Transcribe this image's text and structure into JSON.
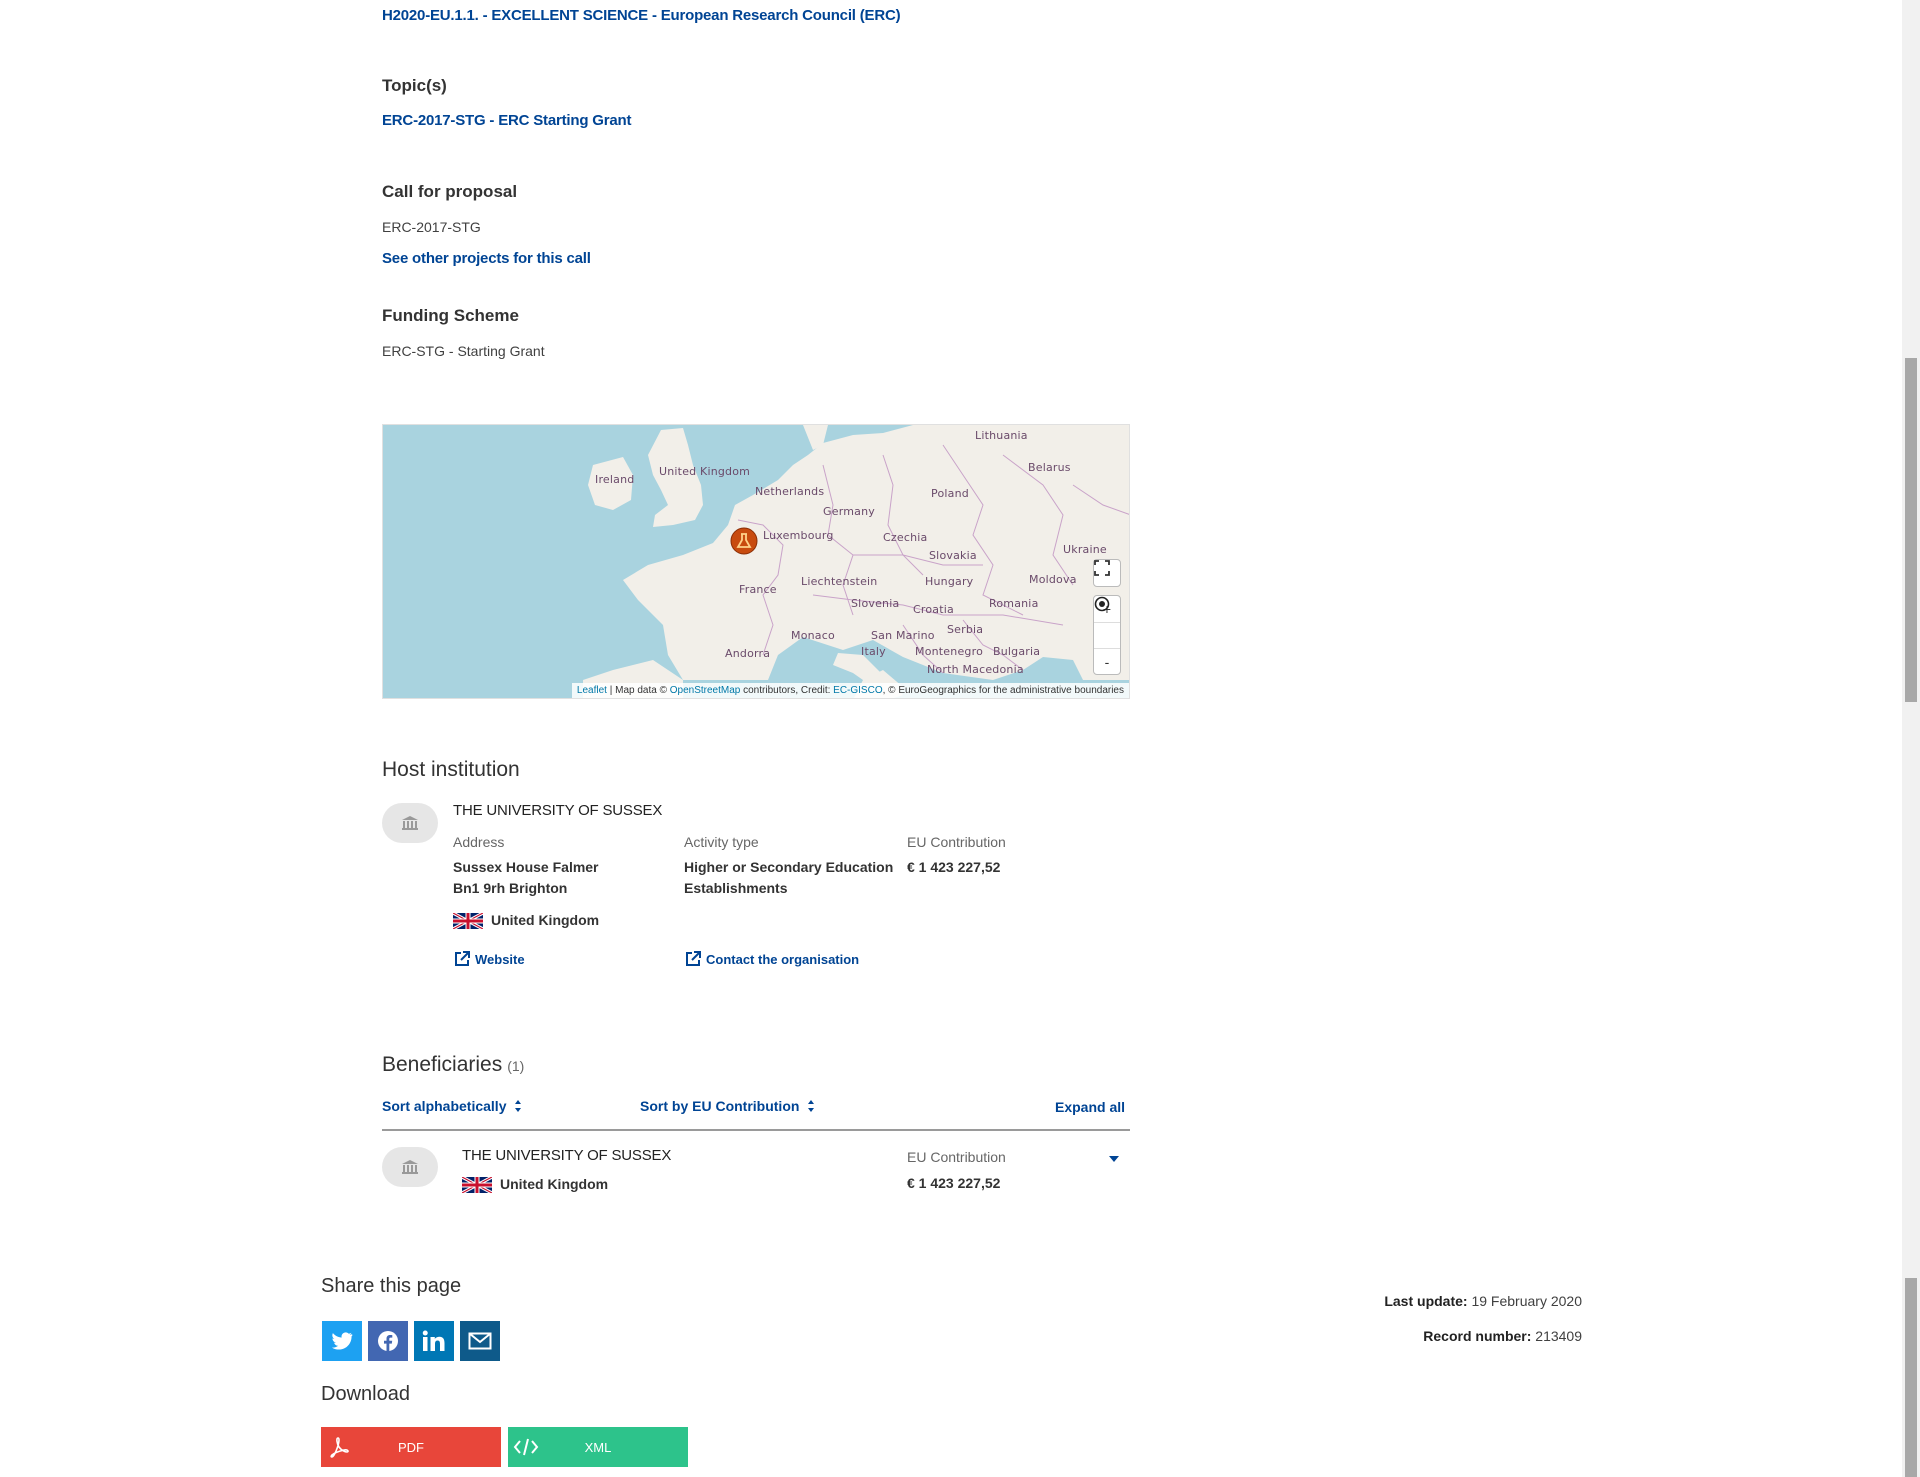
{
  "programme": {
    "link": "H2020-EU.1.1. - EXCELLENT SCIENCE - European Research Council (ERC)"
  },
  "topics": {
    "heading": "Topic(s)",
    "link": "ERC-2017-STG - ERC Starting Grant"
  },
  "call": {
    "heading": "Call for proposal",
    "value": "ERC-2017-STG",
    "link": "See other projects for this call"
  },
  "funding": {
    "heading": "Funding Scheme",
    "value": "ERC-STG - Starting Grant"
  },
  "map": {
    "labels": [
      "Lithuania",
      "Belarus",
      "Ireland",
      "United Kingdom",
      "Netherlands",
      "Poland",
      "Germany",
      "Luxembourg",
      "Czechia",
      "Ukraine",
      "Slovakia",
      "Liechtenstein",
      "Hungary",
      "Moldova",
      "France",
      "Slovenia",
      "Croatia",
      "Romania",
      "Serbia",
      "Monaco",
      "San Marino",
      "Italy",
      "Montenegro",
      "Bulgaria",
      "Andorra",
      "North Macedonia"
    ],
    "zoom_in": "+",
    "zoom_out": "-",
    "attribution": {
      "leaflet": "Leaflet",
      "sep": " | Map data © ",
      "osm": "OpenStreetMap",
      "mid": " contributors, Credit: ",
      "gisco": "EC-GISCO",
      "end": ", © EuroGeographics for the administrative boundaries"
    },
    "colors": {
      "sea": "#a9d3df",
      "land": "#f2efe9",
      "marker": "#c84b0f"
    }
  },
  "host": {
    "heading": "Host institution",
    "name": "THE UNIVERSITY OF SUSSEX",
    "address_label": "Address",
    "address_line1": "Sussex House Falmer",
    "address_line2": "Bn1 9rh Brighton",
    "country": "United Kingdom",
    "activity_label": "Activity type",
    "activity_line1": "Higher or Secondary Education",
    "activity_line2": "Establishments",
    "contribution_label": "EU Contribution",
    "contribution_value": "€ 1 423 227,52",
    "website_link": "Website",
    "contact_link": "Contact the organisation",
    "icon": "institution-icon"
  },
  "beneficiaries": {
    "heading": "Beneficiaries",
    "count": "(1)",
    "sort_alpha": "Sort alphabetically",
    "sort_contrib": "Sort by EU Contribution",
    "expand_all": "Expand all",
    "items": [
      {
        "name": "THE UNIVERSITY OF SUSSEX",
        "country": "United Kingdom",
        "contribution_label": "EU Contribution",
        "contribution_value": "€ 1 423 227,52"
      }
    ]
  },
  "share": {
    "heading": "Share this page",
    "buttons": [
      {
        "name": "twitter",
        "color": "#1da1f2"
      },
      {
        "name": "facebook",
        "color": "#4267b2"
      },
      {
        "name": "linkedin",
        "color": "#0077b5"
      },
      {
        "name": "email",
        "color": "#0e5a8a"
      }
    ]
  },
  "download": {
    "heading": "Download",
    "pdf_label": "PDF",
    "xml_label": "XML",
    "pdf_color": "#e8463a",
    "xml_color": "#2dc38b"
  },
  "meta": {
    "last_update_label": "Last update:",
    "last_update_value": "19 February 2020",
    "record_label": "Record number:",
    "record_value": "213409"
  }
}
